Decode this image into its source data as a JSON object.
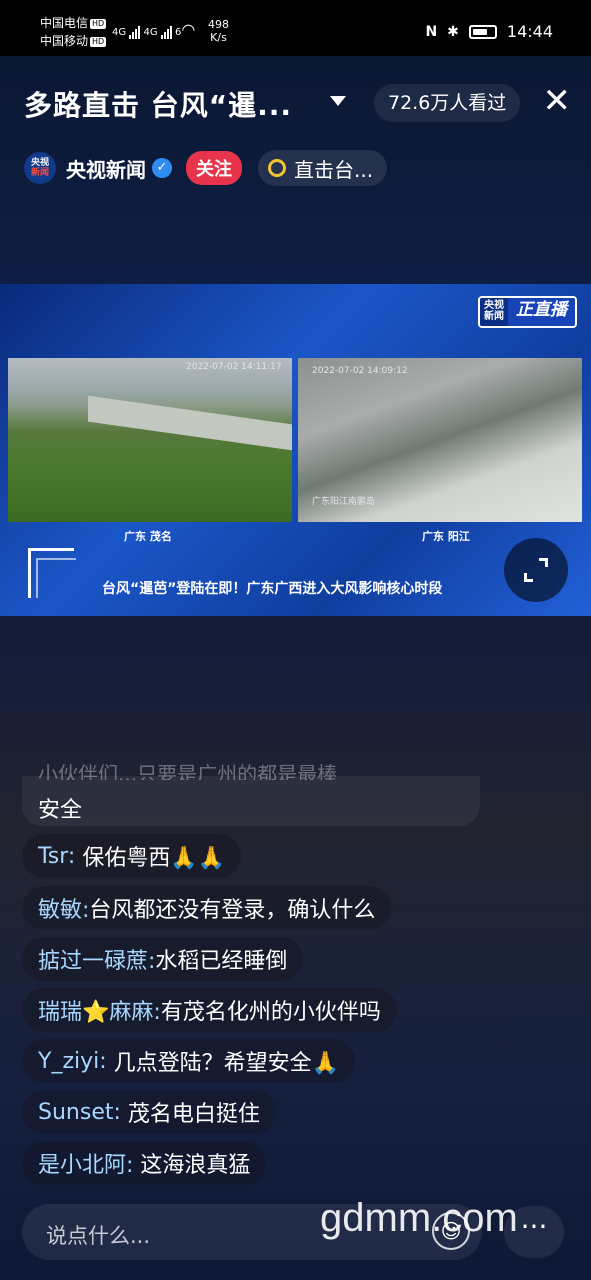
{
  "status_bar": {
    "carrier1": "中国电信",
    "carrier2": "中国移动",
    "hd": "HD",
    "signal_label": "4G",
    "wifi_label": "6",
    "speed_value": "498",
    "speed_unit": "K/s",
    "time": "14:44",
    "battery_level": 0.7
  },
  "header": {
    "title": "多路直击 台风“暹...",
    "viewers": "72.6万人看过",
    "close_icon": "close-icon"
  },
  "channel": {
    "logo_top": "央视",
    "logo_bottom": "新闻",
    "name": "央视新闻",
    "follow_label": "关注",
    "topic_label": "直击台..."
  },
  "video": {
    "badge_top": "央视",
    "badge_bottom": "新闻",
    "badge_live": "正直播",
    "feed1_timestamp": "2022-07-02 14:11:17",
    "feed2_timestamp": "2022-07-02 14:09:12",
    "feed2_overlay": "广东阳江南鹏岛",
    "feed1_caption": "广东 茂名",
    "feed2_caption": "广东 阳江",
    "ticker": "台风“暹芭”登陆在即！广东广西进入大风影响核心时段"
  },
  "chat": {
    "faded_text": "小伙伴们...只要是广州的都是最棒",
    "first_text": "安全",
    "messages": [
      {
        "user": "Tsr:",
        "text": "保佑粤西🙏🙏"
      },
      {
        "user": "敏敏:",
        "text": "台风都还没有登录，确认什么"
      },
      {
        "user": "掂过一碌蔗:",
        "text": "水稻已经睡倒"
      },
      {
        "user": "瑞瑞⭐麻麻:",
        "text": "有茂名化州的小伙伴吗"
      },
      {
        "user": "Y_ziyi:",
        "text": "几点登陆？希望安全🙏"
      },
      {
        "user": "Sunset:",
        "text": "茂名电白挺住"
      },
      {
        "user": "是小北阿:",
        "text": "这海浪真猛"
      }
    ]
  },
  "bottom": {
    "input_placeholder": "说点什么...",
    "emoji_icon": "☺",
    "more_icon": "···",
    "watermark": "gdmm.com"
  }
}
